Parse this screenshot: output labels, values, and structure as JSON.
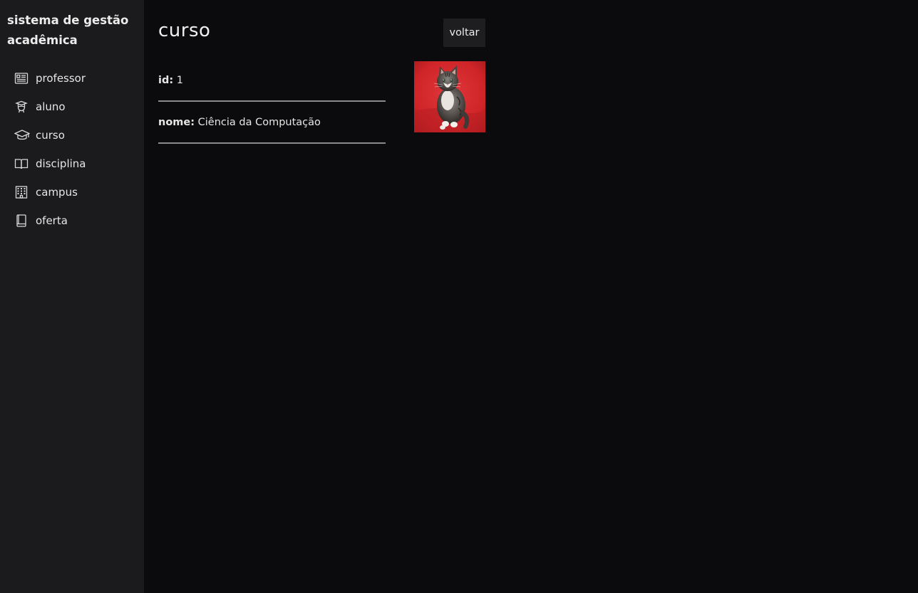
{
  "app": {
    "title": "sistema de gestão acadêmica"
  },
  "sidebar": {
    "items": [
      {
        "label": "professor",
        "icon": "id-card-icon"
      },
      {
        "label": "aluno",
        "icon": "student-icon"
      },
      {
        "label": "curso",
        "icon": "graduation-cap-icon"
      },
      {
        "label": "disciplina",
        "icon": "book-open-icon"
      },
      {
        "label": "campus",
        "icon": "building-icon"
      },
      {
        "label": "oferta",
        "icon": "book-icon"
      }
    ]
  },
  "page": {
    "title": "curso",
    "back_label": "voltar",
    "fields": [
      {
        "key": "id:",
        "value": "1"
      },
      {
        "key": "nome:",
        "value": "Ciência da Computação"
      }
    ],
    "image": {
      "subject": "kitten on red background"
    }
  },
  "colors": {
    "sidebar_bg": "#1b1b1d",
    "main_bg": "#0b0b0d",
    "divider": "#8a8a8c",
    "button_bg": "#1e1e20",
    "thumb_bg": "#d4262b"
  }
}
